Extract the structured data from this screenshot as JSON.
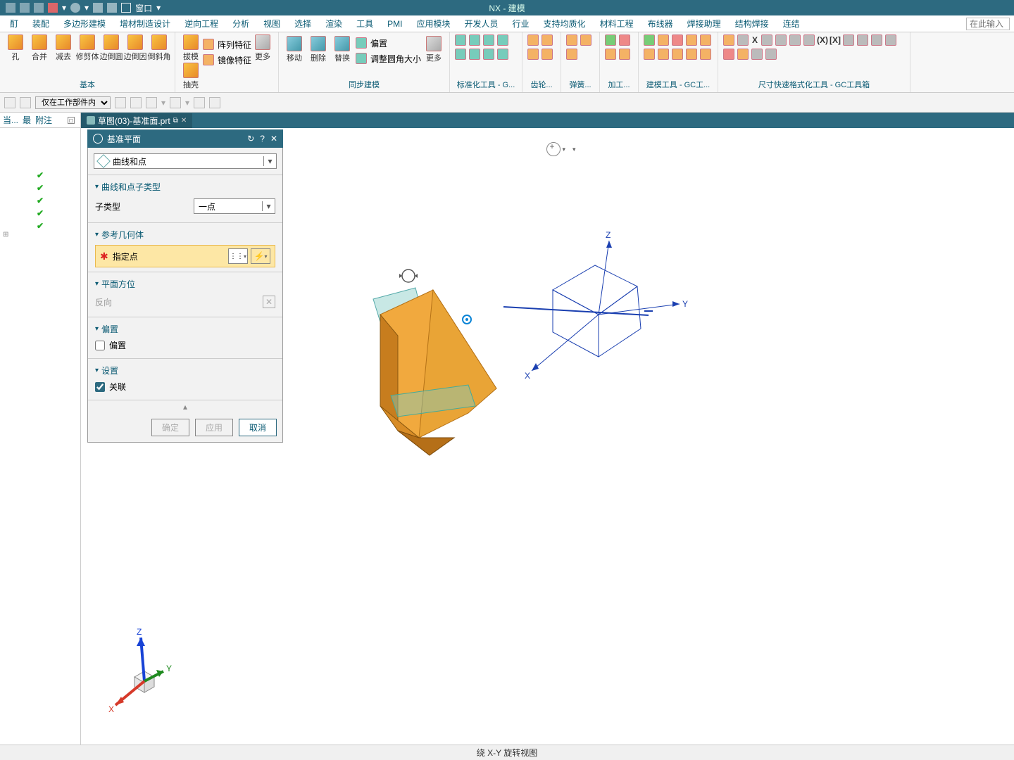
{
  "app": {
    "title": "NX - 建模"
  },
  "menubar": [
    "酊",
    "装配",
    "多边形建模",
    "增材制造设计",
    "逆向工程",
    "分析",
    "视图",
    "选择",
    "渲染",
    "工具",
    "PMI",
    "应用模块",
    "开发人员",
    "行业",
    "支持均质化",
    "材料工程",
    "布线器",
    "焊接助理",
    "结构焊接",
    "连结"
  ],
  "search_placeholder": "在此输入",
  "quickbar": {
    "window_label": "窗口"
  },
  "ribbon": {
    "group1": {
      "items": [
        "孔",
        "合并",
        "减去",
        "修剪体",
        "边倒圆",
        "边倒因",
        "倒斜角"
      ],
      "label": "基本"
    },
    "group2": {
      "items": [
        "拔模",
        "抽壳"
      ],
      "side": [
        "阵列特征",
        "镜像特征"
      ],
      "more": "更多"
    },
    "group3": {
      "items": [
        "移动",
        "删除",
        "替换"
      ],
      "side": [
        "偏置",
        "调整圆角大小"
      ],
      "more": "更多",
      "label": "同步建模"
    },
    "group4": {
      "label": "标准化工具 - G..."
    },
    "group5": {
      "label": "齿轮..."
    },
    "group6": {
      "label": "弹簧..."
    },
    "group7": {
      "label": "加工..."
    },
    "group8": {
      "label": "建模工具 - GC工..."
    },
    "group9": {
      "label": "尺寸快速格式化工具 - GC工具箱"
    }
  },
  "subbar": {
    "filter": "仅在工作部件内"
  },
  "leftcol": {
    "headers": [
      "当...",
      "最",
      "附注"
    ],
    "checks": 5
  },
  "tab": {
    "label": "草图(03)-基准面.prt"
  },
  "dialog": {
    "title": "基准平面",
    "type_value": "曲线和点",
    "sec_subtype": "曲线和点子类型",
    "subtype_label": "子类型",
    "subtype_value": "一点",
    "sec_geom": "参考几何体",
    "specify_point": "指定点",
    "sec_orient": "平面方位",
    "reverse": "反向",
    "sec_offset": "偏置",
    "offset_cb": "偏置",
    "sec_settings": "设置",
    "assoc_cb": "关联",
    "ok": "确定",
    "apply": "应用",
    "cancel": "取消"
  },
  "axes": {
    "x": "X",
    "y": "Y",
    "z": "Z"
  },
  "status": "绕 X-Y 旋转视图"
}
